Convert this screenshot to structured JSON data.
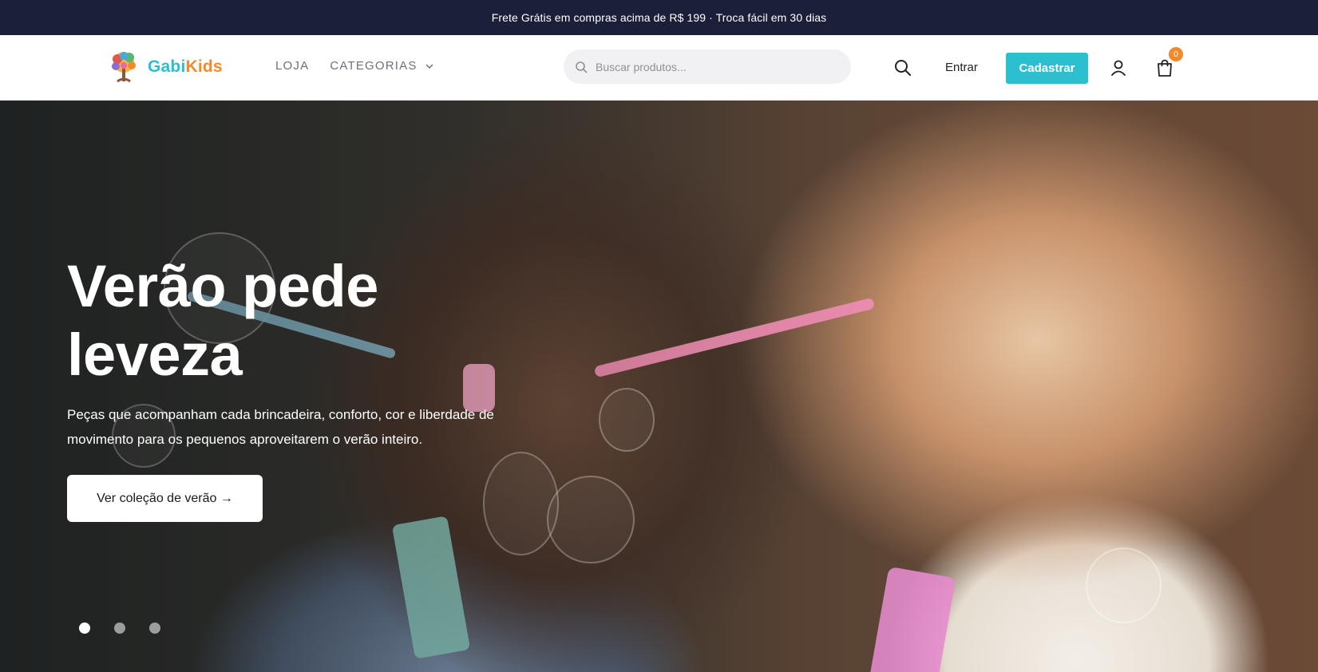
{
  "announcement": "Frete Grátis em compras acima de R$ 199 · Troca fácil em 30 dias",
  "brand": {
    "name_part1": "Gabi",
    "name_part2": "Kids",
    "color1": "#2bbfcf",
    "color2": "#f28a2b"
  },
  "nav": [
    {
      "label": "LOJA"
    },
    {
      "label": "CATEGORIAS",
      "icon": "chevron-down-icon"
    }
  ],
  "search": {
    "placeholder": "Buscar produtos...",
    "value": ""
  },
  "header_actions": {
    "search_icon": "search-icon",
    "login_label": "Entrar",
    "signup_label": "Cadastrar",
    "account_icon": "user-icon",
    "cart_icon": "shopping-bag-icon",
    "cart_count": "0"
  },
  "hero": {
    "title_line1": "Verão pede",
    "title_line2": "leveza",
    "subtitle": "Peças que acompanham cada brincadeira, conforto, cor e liberdade de movimento para os pequenos aproveitarem o verão inteiro.",
    "cta_label": "Ver coleção de verão →",
    "slides_total": 3,
    "active_slide": 1
  },
  "colors": {
    "topbar_bg": "#1c1f3a",
    "accent": "#2bbfcf",
    "badge": "#f28a2b"
  }
}
